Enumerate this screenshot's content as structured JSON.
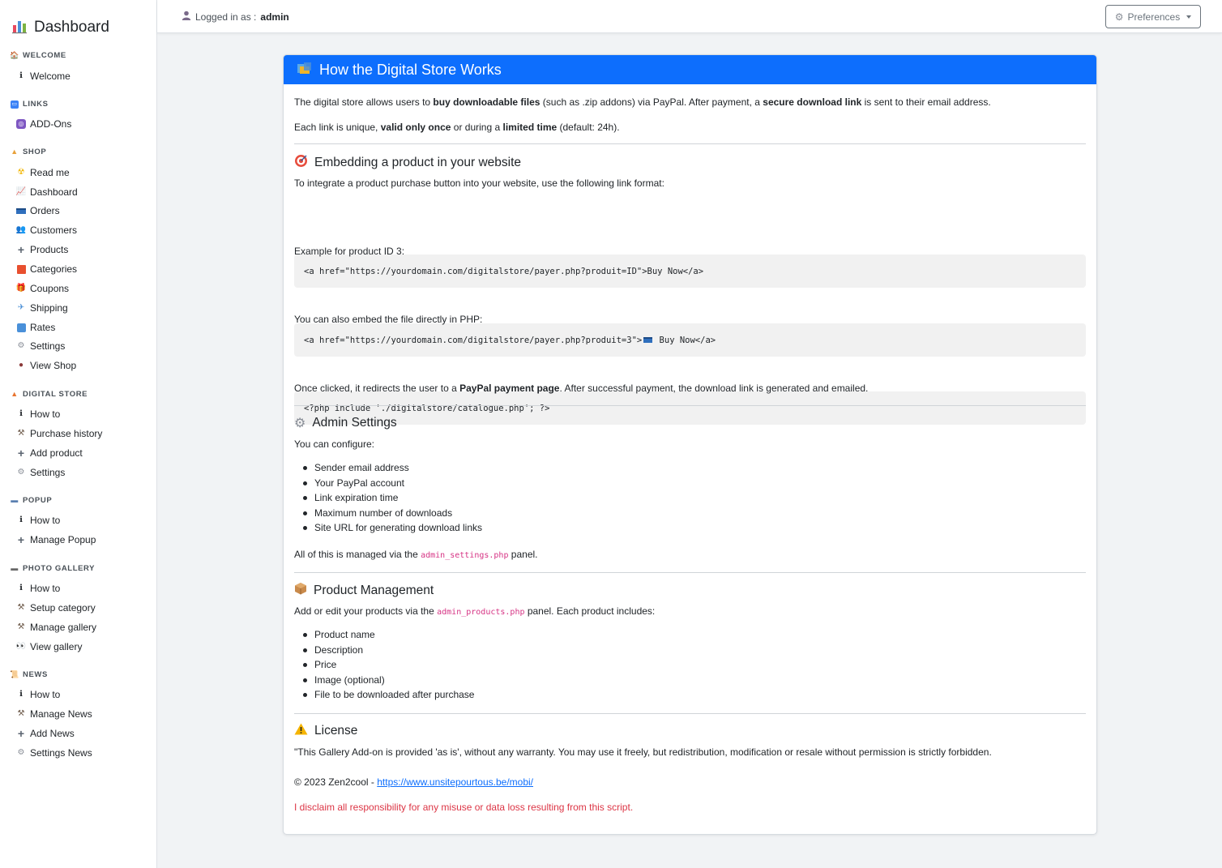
{
  "sidebar": {
    "brand": "Dashboard",
    "sections": [
      {
        "title": "WELCOME",
        "items": [
          "Welcome"
        ]
      },
      {
        "title": "LINKS",
        "items": [
          "ADD-Ons"
        ]
      },
      {
        "title": "SHOP",
        "items": [
          "Read me",
          "Dashboard",
          "Orders",
          "Customers",
          "Products",
          "Categories",
          "Coupons",
          "Shipping",
          "Rates",
          "Settings",
          "View Shop"
        ]
      },
      {
        "title": "DIGITAL STORE",
        "items": [
          "How to",
          "Purchase history",
          "Add product",
          "Settings"
        ]
      },
      {
        "title": "POPUP",
        "items": [
          "How to",
          "Manage Popup"
        ]
      },
      {
        "title": "PHOTO GALLERY",
        "items": [
          "How to",
          "Setup category",
          "Manage gallery",
          "View gallery"
        ]
      },
      {
        "title": "NEWS",
        "items": [
          "How to",
          "Manage News",
          "Add News",
          "Settings News"
        ]
      }
    ]
  },
  "topbar": {
    "logged_prefix": "Logged in as :",
    "username": "admin",
    "preferences_label": "Preferences"
  },
  "card": {
    "title": "How the Digital Store Works",
    "intro1": {
      "a": "The digital store allows users to ",
      "b": "buy downloadable files",
      "c": " (such as .zip addons) via PayPal. After payment, a ",
      "d": "secure download link",
      "e": " is sent to their email address."
    },
    "intro2": {
      "a": "Each link is unique, ",
      "b": "valid only once",
      "c": " or during a ",
      "d": "limited time",
      "e": " (default: 24h)."
    },
    "embed_title": "Embedding a product in your website",
    "embed_text": "To integrate a product purchase button into your website, use the following link format:",
    "code1": "<a href=\"https://yourdomain.com/digitalstore/payer.php?produit=ID\">Buy Now</a>",
    "example_label": "Example for product ID 3:",
    "code2_a": "<a href=\"https://yourdomain.com/digitalstore/payer.php?produit=3\">",
    "code2_b": " Buy Now</a>",
    "php_label": "You can also embed the file directly in PHP:",
    "code3": "<?php include './digitalstore/catalogue.php'; ?>",
    "redirect": {
      "a": "Once clicked, it redirects the user to a ",
      "b": "PayPal payment page",
      "c": ". After successful payment, the download link is generated and emailed."
    },
    "admin_title": "Admin Settings",
    "admin_text": "You can configure:",
    "admin_items": [
      "Sender email address",
      "Your PayPal account",
      "Link expiration time",
      "Maximum number of downloads",
      "Site URL for generating download links"
    ],
    "admin_managed": {
      "a": "All of this is managed via the ",
      "code": "admin_settings.php",
      "c": " panel."
    },
    "product_title": "Product Management",
    "product_text": {
      "a": "Add or edit your products via the ",
      "code": "admin_products.php",
      "c": " panel. Each product includes:"
    },
    "product_items": [
      "Product name",
      "Description",
      "Price",
      "Image (optional)",
      "File to be downloaded after purchase"
    ],
    "license_title": "License",
    "license_text": "\"This Gallery Add-on is provided 'as is', without any warranty. You may use it freely, but redistribution, modification or resale without permission is strictly forbidden.",
    "copyright_prefix": "© 2023 Zen2cool - ",
    "copyright_link": "https://www.unsitepourtous.be/mobi/",
    "disclaimer": "I disclaim all responsibility for any misuse or data loss resulting from this script."
  },
  "colors": {
    "primary": "#0d6efd",
    "danger": "#dc3545",
    "code_pink": "#d63384"
  }
}
